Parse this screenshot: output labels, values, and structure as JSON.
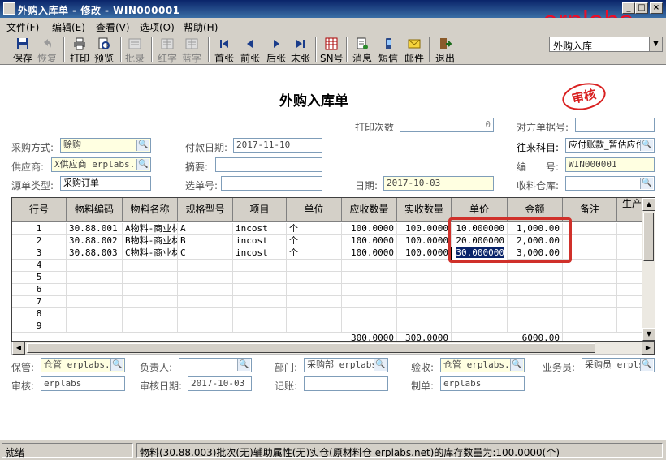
{
  "window": {
    "title": "外购入库单 - 修改 - WIN000001",
    "brand": "erplabs",
    "min": "_",
    "max": "□",
    "close": "×"
  },
  "menu": [
    "文件(F)",
    "编辑(E)",
    "查看(V)",
    "选项(O)",
    "帮助(H)"
  ],
  "toolbar": {
    "buttons": [
      {
        "label": "保存",
        "icon": "save-icon"
      },
      {
        "label": "恢复",
        "icon": "undo-icon"
      },
      {
        "label": "打印",
        "icon": "printer-icon"
      },
      {
        "label": "预览",
        "icon": "preview-icon"
      },
      {
        "label": "批录",
        "icon": "batch-entry-icon"
      },
      {
        "label": "红字",
        "icon": "red-invoice-icon"
      },
      {
        "label": "蓝字",
        "icon": "blue-invoice-icon"
      },
      {
        "label": "首张",
        "icon": "first-record-icon"
      },
      {
        "label": "前张",
        "icon": "previous-record-icon"
      },
      {
        "label": "后张",
        "icon": "next-record-icon"
      },
      {
        "label": "末张",
        "icon": "last-record-icon"
      },
      {
        "label": "SN号",
        "icon": "serial-number-icon"
      },
      {
        "label": "消息",
        "icon": "message-icon"
      },
      {
        "label": "短信",
        "icon": "sms-icon"
      },
      {
        "label": "邮件",
        "icon": "mail-icon"
      },
      {
        "label": "退出",
        "icon": "exit-icon"
      }
    ],
    "view_select": "外购入库"
  },
  "form": {
    "title": "外购入库单",
    "stamp": "审核",
    "print_count_label": "打印次数",
    "print_count": "0",
    "counter_doc_label": "对方单据号:",
    "counter_doc": "",
    "purchase_mode_label": "采购方式:",
    "purchase_mode": "赊购",
    "pay_date_label": "付款日期:",
    "pay_date": "2017-11-10",
    "account_label": "往来科目:",
    "account": "应付账款_暂估应付",
    "supplier_label": "供应商:",
    "supplier": "X供应商 erplabs.n",
    "summary_label": "摘要:",
    "summary": "",
    "number_label": "编　　号:",
    "number": "WIN000001",
    "source_type_label": "源单类型:",
    "source_type": "采购订单",
    "select_no_label": "选单号:",
    "select_no": "",
    "date_label": "日期:",
    "date": "2017-10-03",
    "warehouse_label": "收料仓库:",
    "warehouse": ""
  },
  "grid": {
    "columns": [
      "行号",
      "物料编码",
      "物料名称",
      "规格型号",
      "项目",
      "单位",
      "应收数量",
      "实收数量",
      "单价",
      "金额",
      "备注",
      "生产日"
    ],
    "rows": [
      {
        "no": "1",
        "code": "30.88.001",
        "name": "A物料-商业材",
        "spec": "A",
        "item": "incost",
        "unit": "个",
        "qty_due": "100.0000",
        "qty_recv": "100.0000",
        "price": "10.000000",
        "amount": "1,000.00"
      },
      {
        "no": "2",
        "code": "30.88.002",
        "name": "B物料-商业材",
        "spec": "B",
        "item": "incost",
        "unit": "个",
        "qty_due": "100.0000",
        "qty_recv": "100.0000",
        "price": "20.000000",
        "amount": "2,000.00"
      },
      {
        "no": "3",
        "code": "30.88.003",
        "name": "C物料-商业材",
        "spec": "C",
        "item": "incost",
        "unit": "个",
        "qty_due": "100.0000",
        "qty_recv": "100.0000",
        "price": "30.000000",
        "amount": "3,000.00"
      },
      {
        "no": "4"
      },
      {
        "no": "5"
      },
      {
        "no": "6"
      },
      {
        "no": "7"
      },
      {
        "no": "8"
      },
      {
        "no": "9"
      }
    ],
    "totals": {
      "qty_due": "300.0000",
      "qty_recv": "300.0000",
      "amount": "6000.00"
    }
  },
  "footer": {
    "keeper_label": "保管:",
    "keeper": "仓管 erplabs.n",
    "owner_label": "负责人:",
    "owner": "",
    "dept_label": "部门:",
    "dept": "采购部 erplabs",
    "inspect_label": "验收:",
    "inspect": "仓管 erplabs.n",
    "salesman_label": "业务员:",
    "salesman": "采购员 erpls",
    "auditor_label": "审核:",
    "auditor": "erplabs",
    "audit_date_label": "审核日期:",
    "audit_date": "2017-10-03",
    "bookkeeper_label": "记账:",
    "bookkeeper": "",
    "maker_label": "制单:",
    "maker": "erplabs"
  },
  "status": {
    "left": "就绪",
    "right": "物料(30.88.003)批次(无)辅助属性(无)实仓(原材料仓 erplabs.net)的库存数量为:100.0000(个)"
  }
}
